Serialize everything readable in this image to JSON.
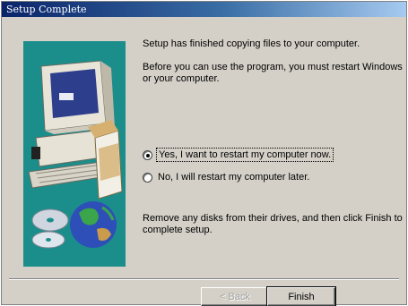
{
  "window": {
    "title": "Setup Complete"
  },
  "content": {
    "message_1": "Setup has finished copying files to your computer.",
    "message_2": "Before you can use the program, you must restart Windows or your computer.",
    "message_3": "Remove any disks from their drives, and then click Finish to complete setup."
  },
  "options": {
    "restart_now": {
      "label": "Yes, I want to restart my computer now.",
      "selected": true
    },
    "restart_later": {
      "label": "No, I will restart my computer later.",
      "selected": false
    }
  },
  "buttons": {
    "back_label": "< Back",
    "finish_label": "Finish"
  },
  "colors": {
    "side_panel": "#1b8e8b",
    "titlebar": "#0a246a",
    "dialog": "#d4d0c8"
  }
}
